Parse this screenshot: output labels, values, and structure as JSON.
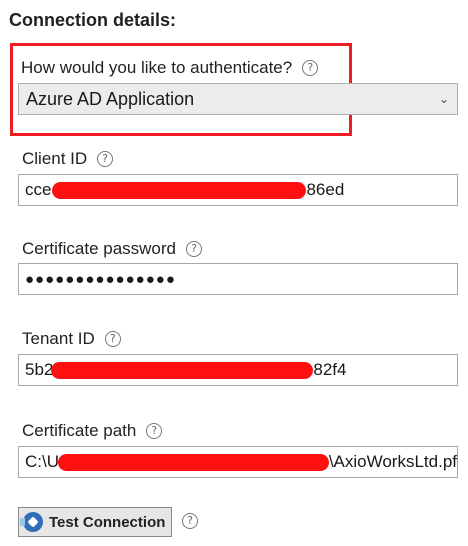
{
  "section_title": "Connection details:",
  "auth": {
    "label": "How would you like to authenticate?",
    "selected": "Azure AD Application"
  },
  "client_id": {
    "label": "Client ID",
    "prefix": "cce",
    "suffix": "86ed"
  },
  "cert_password": {
    "label": "Certificate password",
    "value": "●●●●●●●●●●●●●●●"
  },
  "tenant_id": {
    "label": "Tenant ID",
    "prefix": "5b2",
    "suffix": "82f4"
  },
  "cert_path": {
    "label": "Certificate path",
    "prefix": "C:\\U",
    "suffix": "\\AxioWorksLtd.pf"
  },
  "test_button": {
    "label": "Test Connection"
  },
  "help_glyph": "?",
  "colors": {
    "highlight_box": "#ee1c25",
    "redaction": "#ff1010",
    "button_icon": "#2f6db5"
  }
}
